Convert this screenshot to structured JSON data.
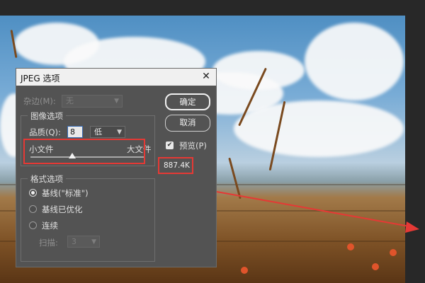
{
  "dialog": {
    "title": "JPEG 选项",
    "close_glyph": "✕"
  },
  "matte": {
    "label": "杂边(M):",
    "value": "无"
  },
  "image_options": {
    "group_label": "图像选项",
    "quality_label": "品质(Q):",
    "quality_value": "8",
    "quality_level": "低",
    "slider_min_label": "小文件",
    "slider_max_label": "大文件",
    "slider_position": 0.37
  },
  "format_options": {
    "group_label": "格式选项",
    "options": [
      {
        "label": "基线(\"标准\")",
        "selected": true
      },
      {
        "label": "基线已优化",
        "selected": false
      },
      {
        "label": "连续",
        "selected": false
      }
    ],
    "scans_label": "扫描:",
    "scans_value": "3"
  },
  "buttons": {
    "ok": "确定",
    "cancel": "取消"
  },
  "preview": {
    "label": "预览(P)",
    "checked": true,
    "file_size": "887.4K"
  },
  "colors": {
    "annotation_red": "#e53935",
    "dialog_bg": "#535353"
  }
}
